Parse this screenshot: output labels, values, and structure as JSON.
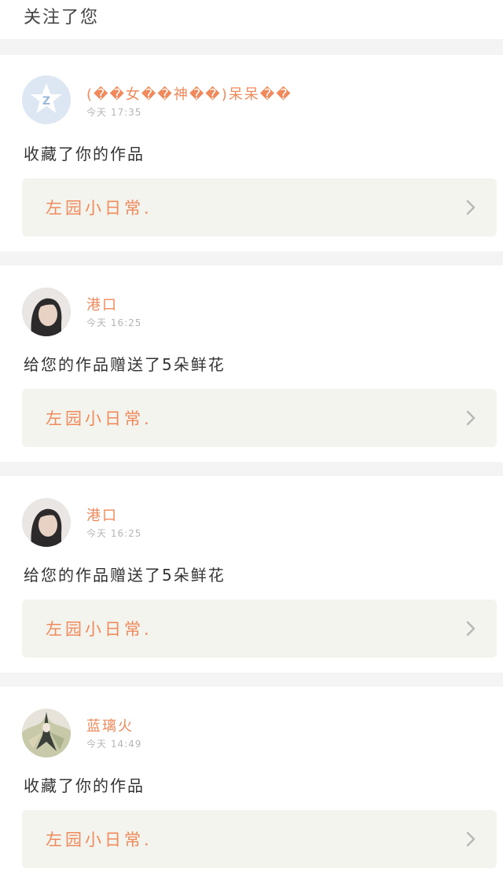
{
  "header": {
    "text": "关注了您"
  },
  "notifications": [
    {
      "user": "(��女��神��)呆呆��",
      "time": "今天 17:35",
      "action": "收藏了你的作品",
      "work_title": "左园小日常.",
      "avatar": "default-avatar-icon"
    },
    {
      "user": "港口",
      "time": "今天 16:25",
      "action": "给您的作品赠送了5朵鲜花",
      "work_title": "左园小日常.",
      "avatar": "portrait-avatar"
    },
    {
      "user": "港口",
      "time": "今天 16:25",
      "action": "给您的作品赠送了5朵鲜花",
      "work_title": "左园小日常.",
      "avatar": "portrait-avatar"
    },
    {
      "user": "蓝璃火",
      "time": "今天 14:49",
      "action": "收藏了你的作品",
      "work_title": "左园小日常.",
      "avatar": "anime-avatar"
    }
  ],
  "colors": {
    "accent": "#f08a5c",
    "work_box_bg": "#f4f4ee",
    "separator": "#f4f4f4"
  }
}
